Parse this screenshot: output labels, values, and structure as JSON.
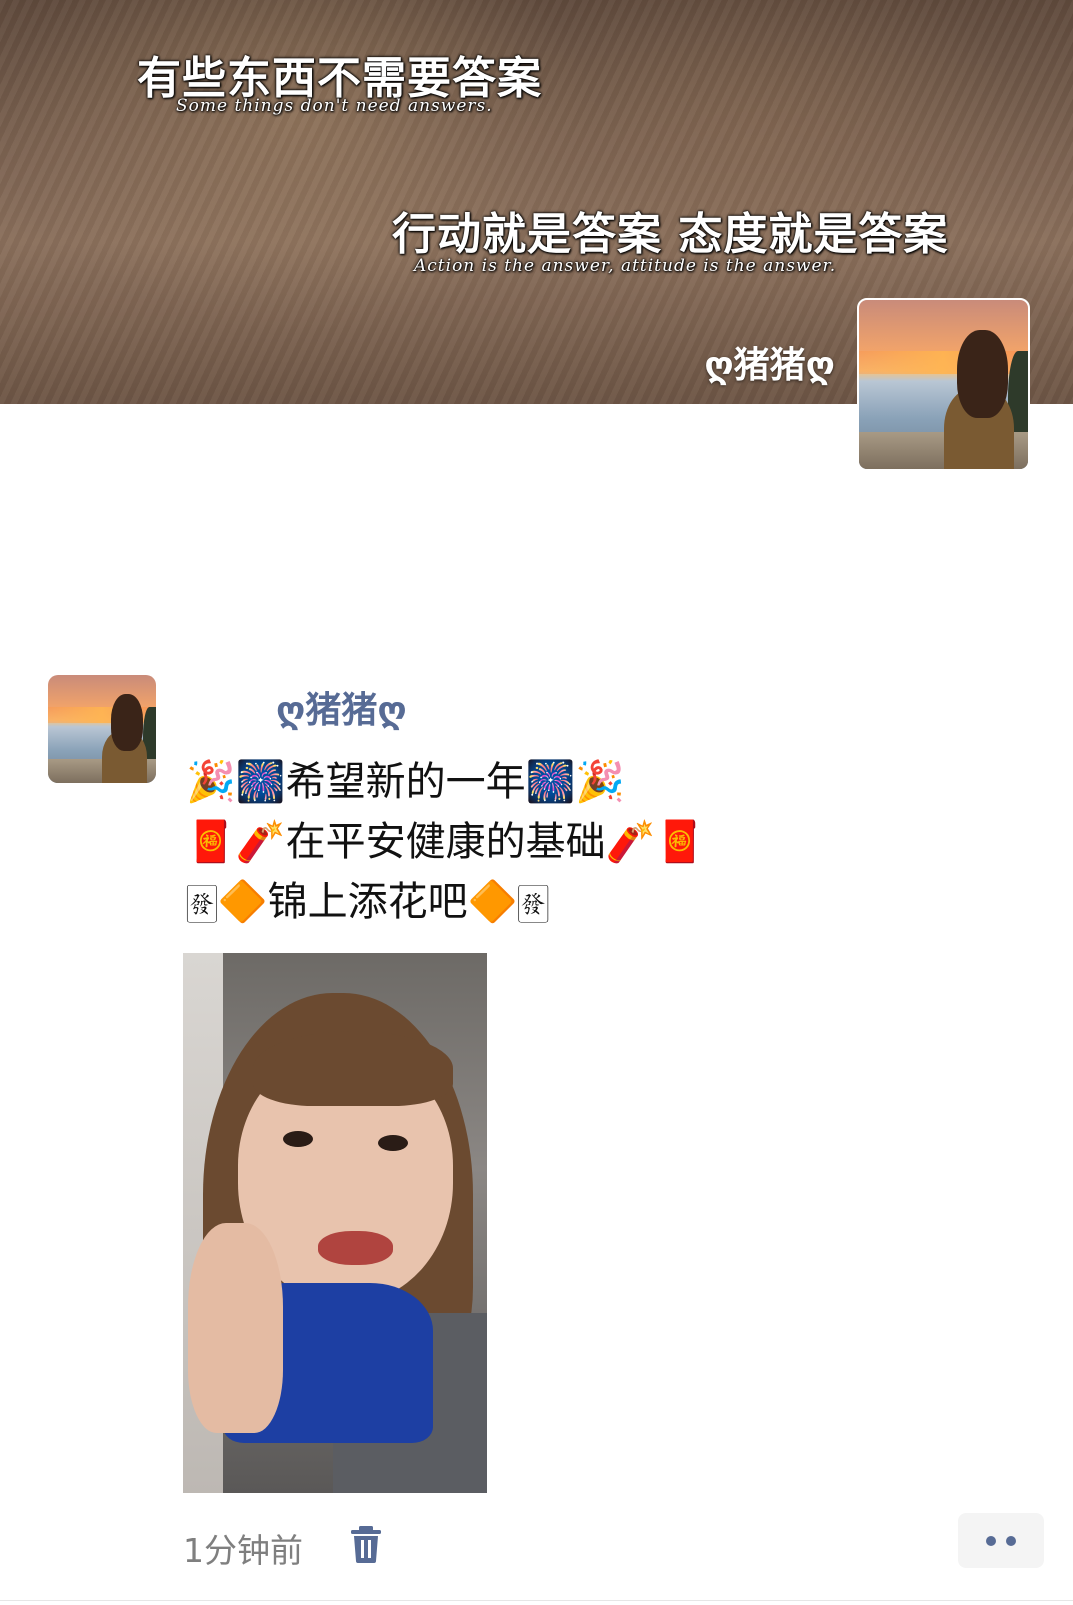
{
  "cover": {
    "quote_line1_zh": "有些东西不需要答案",
    "quote_line1_en": "Some things don't need answers.",
    "quote_line2_zh": "行动就是答案  态度就是答案",
    "quote_line2_en": "Action is the answer, attitude is the answer.",
    "username": "ღ猪猪ღ",
    "avatar_icon": "profile-avatar-icon"
  },
  "post": {
    "author": "ღ猪猪ღ",
    "text_lines": [
      "🎉🎆希望新的一年🎆🎉",
      "🧧🧨在平安健康的基础🧨🧧",
      "🀅🔶锦上添花吧🔶🀅"
    ],
    "photo_icon": "selfie-photo",
    "time": "1分钟前",
    "delete_icon": "trash-icon",
    "more_icon": "more-dots-icon"
  },
  "colors": {
    "author_link": "#576b95",
    "time_text": "#7f7f7f",
    "body_text": "#111111",
    "more_button_bg": "#f4f4f4"
  }
}
